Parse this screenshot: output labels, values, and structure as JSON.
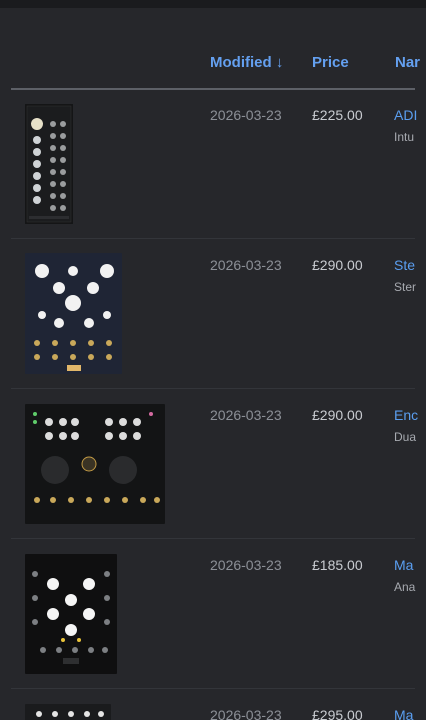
{
  "table": {
    "headers": {
      "modified": "Modified ↓",
      "price": "Price",
      "name": "Nar"
    },
    "rows": [
      {
        "date": "2026-03-23",
        "price": "£225.00",
        "name": "ADI",
        "maker": "Intu"
      },
      {
        "date": "2026-03-23",
        "price": "£290.00",
        "name": "Ste",
        "maker": "Ster"
      },
      {
        "date": "2026-03-23",
        "price": "£290.00",
        "name": "Enc",
        "maker": "Dua"
      },
      {
        "date": "2026-03-23",
        "price": "£185.00",
        "name": "Ma",
        "maker": "Ana"
      },
      {
        "date": "2026-03-23",
        "price": "£295.00",
        "name": "Ma",
        "maker": ""
      }
    ]
  }
}
